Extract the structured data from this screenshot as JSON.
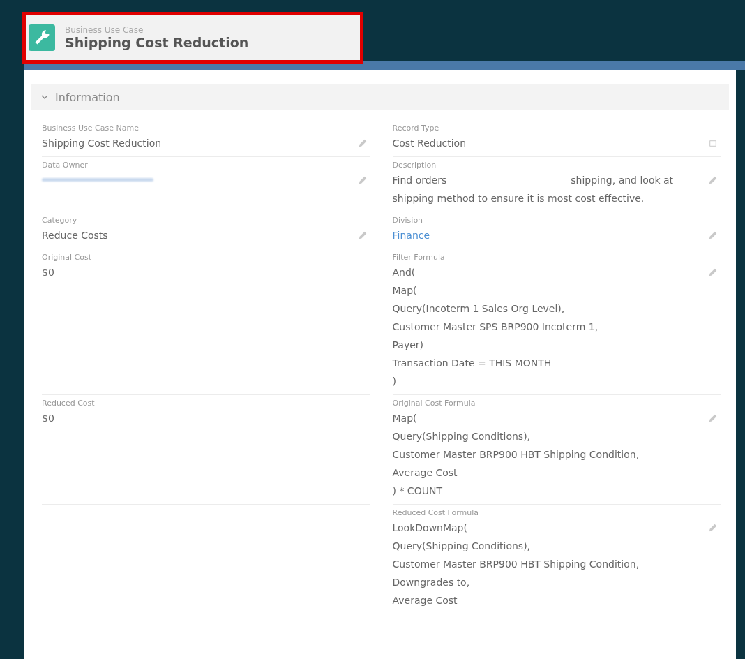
{
  "header": {
    "object_type": "Business Use Case",
    "title": "Shipping Cost Reduction",
    "highlighted": true
  },
  "section": {
    "title": "Information",
    "expanded": true
  },
  "rows": [
    {
      "left": {
        "label": "Business Use Case Name",
        "lines": [
          "Shipping Cost Reduction"
        ],
        "kind": "edit"
      },
      "right": {
        "label": "Record Type",
        "lines": [
          "Cost Reduction"
        ],
        "kind": "change"
      }
    },
    {
      "left": {
        "label": "Data Owner",
        "redacted": true,
        "kind": "edit"
      },
      "right": {
        "label": "Description",
        "lines": [
          "Find orders                                        shipping, and look at shipping method to ensure it is most cost effective."
        ],
        "kind": "edit"
      }
    },
    {
      "left": {
        "label": "Category",
        "lines": [
          "Reduce Costs"
        ],
        "kind": "edit"
      },
      "right": {
        "label": "Division",
        "lines": [
          "Finance"
        ],
        "link": true,
        "kind": "edit"
      }
    },
    {
      "left": {
        "label": "Original Cost",
        "lines": [
          "$0"
        ],
        "kind": "readonly"
      },
      "right": {
        "label": "Filter Formula",
        "lines": [
          "And(",
          "Map(",
          "Query(Incoterm 1 Sales Org Level),",
          "Customer Master SPS BRP900 Incoterm 1,",
          "Payer)",
          "Transaction Date = THIS MONTH",
          ")"
        ],
        "kind": "edit"
      }
    },
    {
      "left": {
        "label": "Reduced Cost",
        "lines": [
          "$0"
        ],
        "kind": "readonly"
      },
      "right": {
        "label": "Original Cost Formula",
        "lines": [
          "Map(",
          "Query(Shipping Conditions),",
          "Customer Master BRP900 HBT Shipping Condition,",
          "Average Cost",
          ") * COUNT"
        ],
        "kind": "edit"
      }
    },
    {
      "left": null,
      "right": {
        "label": "Reduced Cost Formula",
        "lines": [
          "LookDownMap(",
          "Query(Shipping Conditions),",
          "Customer Master BRP900 HBT Shipping Condition,",
          "Downgrades to,",
          "Average Cost"
        ],
        "kind": "edit"
      }
    }
  ]
}
